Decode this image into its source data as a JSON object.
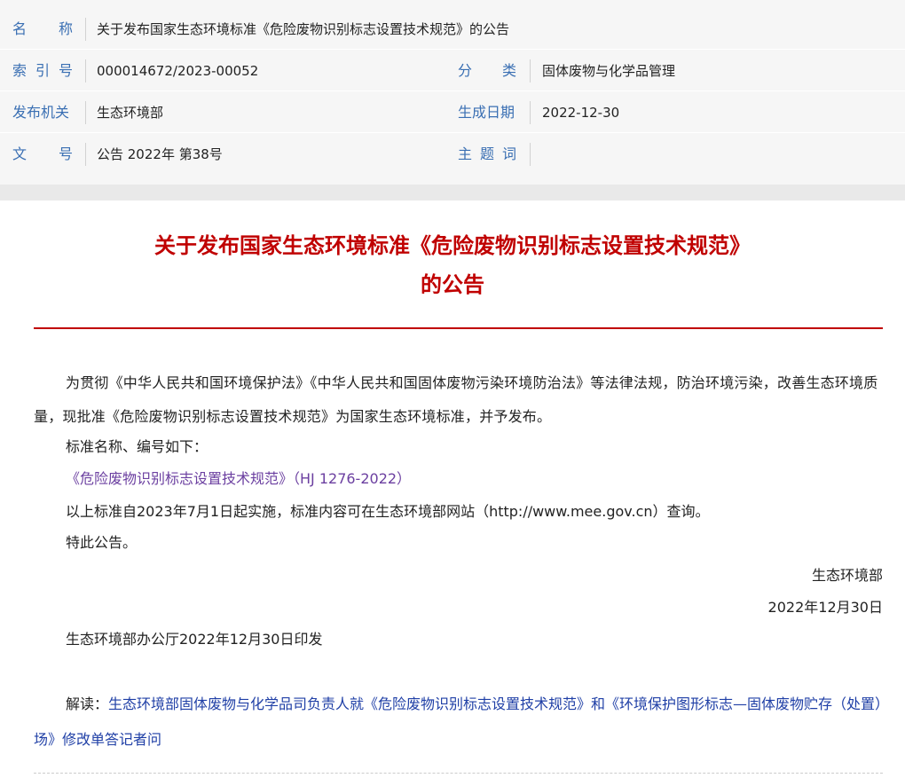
{
  "meta": {
    "name_label_chars": [
      "名",
      "称"
    ],
    "name_value": "关于发布国家生态环境标准《危险废物识别标志设置技术规范》的公告",
    "index_label_chars": [
      "索",
      "引",
      "号"
    ],
    "index_value": "000014672/2023-00052",
    "category_label_chars": [
      "分",
      "类"
    ],
    "category_value": "固体废物与化学品管理",
    "issuer_label": "发布机关",
    "issuer_value": "生态环境部",
    "date_label": "生成日期",
    "date_value": "2022-12-30",
    "docno_label_chars": [
      "文",
      "号"
    ],
    "docno_value": "公告 2022年 第38号",
    "keywords_label_chars": [
      "主",
      "题",
      "词"
    ],
    "keywords_value": ""
  },
  "article": {
    "title_line1": "关于发布国家生态环境标准《危险废物识别标志设置技术规范》",
    "title_line2": "的公告",
    "intro": "为贯彻《中华人民共和国环境保护法》《中华人民共和国固体废物污染环境防治法》等法律法规，防治环境污染，改善生态环境质量，现批准《危险废物识别标志设置技术规范》为国家生态环境标准，并予发布。",
    "list_head": "标准名称、编号如下：",
    "standard_link": "《危险废物识别标志设置技术规范》（HJ 1276-2022）",
    "implementation": "以上标准自2023年7月1日起实施，标准内容可在生态环境部网站（http://www.mee.gov.cn）查询。",
    "notice": "特此公告。",
    "signature_org": "生态环境部",
    "signature_date": "2022年12月30日",
    "print_note": "生态环境部办公厅2022年12月30日印发",
    "interp_label": "解读：",
    "interp_link": "生态环境部固体废物与化学品司负责人就《危险废物识别标志设置技术规范》和《环境保护图形标志—固体废物贮存（处置）场》修改单答记者问"
  }
}
